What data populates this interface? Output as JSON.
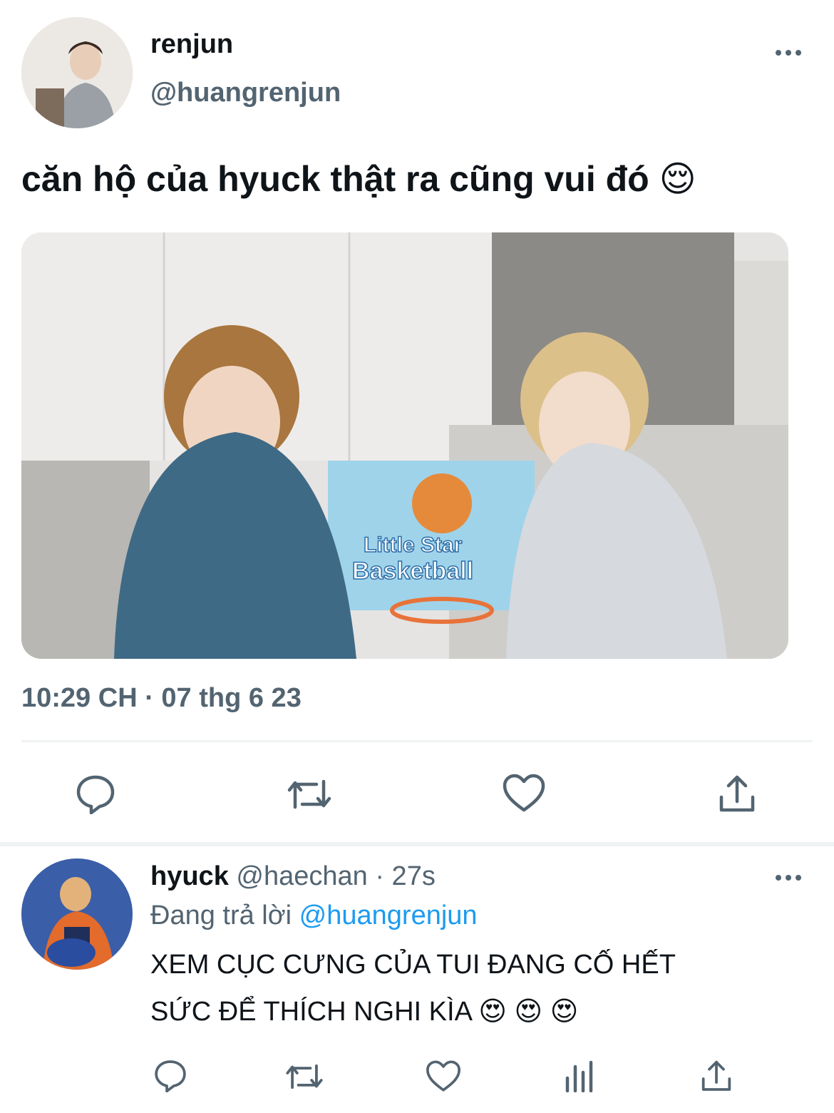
{
  "main_tweet": {
    "display_name": "renjun",
    "handle": "@huangrenjun",
    "text": "căn hộ của hyuck thật ra cũng vui đó 😌",
    "image_text": {
      "line1": "Little Star",
      "line2": "Basketball"
    },
    "timestamp": "10:29 CH · 07 thg 6 23",
    "actions": [
      "reply-icon",
      "retweet-icon",
      "like-icon",
      "share-icon"
    ]
  },
  "reply": {
    "display_name": "hyuck",
    "handle": "@haechan",
    "time": "· 27s",
    "replying_prefix": "Đang trả lời",
    "replying_to": "@huangrenjun",
    "text_line1": "XEM CỤC CƯNG CỦA TUI ĐANG CỐ HẾT",
    "text_line2": "SỨC ĐỂ THÍCH NGHI KÌA 😍 😍 😍",
    "actions": [
      "reply-icon",
      "retweet-icon",
      "like-icon",
      "analytics-icon",
      "share-icon"
    ]
  },
  "colors": {
    "text": "#0f1419",
    "muted": "#536471",
    "accent": "#1d9bf0",
    "divider": "#eff3f4"
  }
}
